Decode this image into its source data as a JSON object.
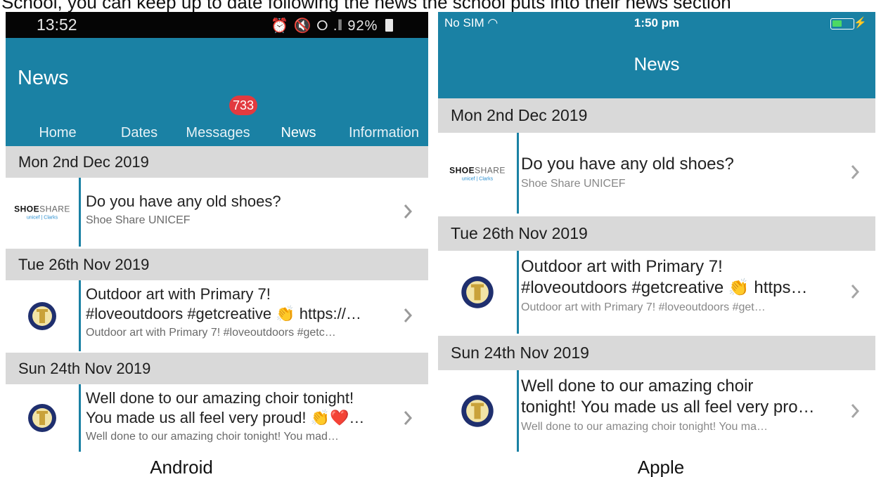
{
  "top_caption": "School, you can keep up to date following the news the school puts into their news section",
  "android": {
    "caption": "Android",
    "status": {
      "time": "13:52",
      "icons": "⏰ 🔇 ⭘ .∥",
      "battery": "92%"
    },
    "header": {
      "title": "News"
    },
    "tabs": [
      {
        "label": "Home"
      },
      {
        "label": "Dates"
      },
      {
        "label": "Messages",
        "badge": "733"
      },
      {
        "label": "News",
        "active": true
      },
      {
        "label": "Information"
      }
    ],
    "sections": [
      {
        "date": "Mon 2nd Dec 2019",
        "item": {
          "thumb": "shoe-share-logo",
          "headline": "Do you have any old shoes?",
          "sub": "Shoe Share UNICEF"
        }
      },
      {
        "date": "Tue 26th Nov 2019",
        "item": {
          "thumb": "school-crest",
          "headline": "Outdoor art with Primary 7!\n#loveoutdoors #getcreative 👏 https://…",
          "sub": "Outdoor art with Primary 7! #loveoutdoors #getc…"
        }
      },
      {
        "date": "Sun 24th Nov 2019",
        "item": {
          "thumb": "school-crest",
          "headline": "Well done to our amazing choir tonight!\nYou made us all feel very proud! 👏❤️…",
          "sub": "Well done to our amazing choir tonight! You mad…"
        }
      }
    ]
  },
  "apple": {
    "caption": "Apple",
    "status": {
      "carrier": "No SIM ◠",
      "time": "1:50 pm",
      "charging": "⚡"
    },
    "header": {
      "title": "News"
    },
    "sections": [
      {
        "date": "Mon 2nd Dec 2019",
        "item": {
          "thumb": "shoe-share-logo",
          "headline": "Do you have any old shoes?",
          "sub": "Shoe Share UNICEF"
        }
      },
      {
        "date": "Tue 26th Nov 2019",
        "item": {
          "thumb": "school-crest",
          "headline": "Outdoor art with Primary 7!\n#loveoutdoors #getcreative 👏 https…",
          "sub": "Outdoor art with Primary 7! #loveoutdoors #get…"
        }
      },
      {
        "date": "Sun 24th Nov 2019",
        "item": {
          "thumb": "school-crest",
          "headline": "Well done to our amazing choir\ntonight! You made us all feel very pro…",
          "sub": "Well done to our amazing choir tonight! You ma…"
        }
      }
    ]
  },
  "logo": {
    "shoe_word_1": "SHOE",
    "shoe_word_2": "SHARE",
    "partners": "unicef | Clarks"
  },
  "colors": {
    "header": "#1a81a4",
    "badge": "#e23a3f",
    "date_band": "#d9d9d9",
    "accent_bar": "#1a81a4"
  }
}
